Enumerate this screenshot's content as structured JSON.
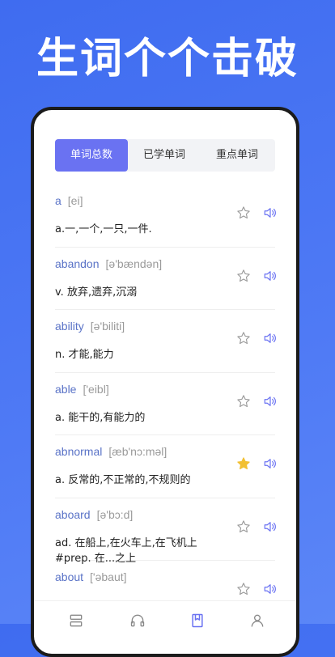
{
  "headline": "生词个个击破",
  "tabs": [
    {
      "label": "单词总数",
      "active": true
    },
    {
      "label": "已学单词",
      "active": false
    },
    {
      "label": "重点单词",
      "active": false
    }
  ],
  "words": [
    {
      "word": "a",
      "phonetic": "[ei]",
      "meaning": "a.一,一个,一只,一件.",
      "starred": false
    },
    {
      "word": "abandon",
      "phonetic": "[ə'bændən]",
      "meaning": "v. 放弃,遗弃,沉溺",
      "starred": false
    },
    {
      "word": "ability",
      "phonetic": "[ə'biliti]",
      "meaning": "n. 才能,能力",
      "starred": false
    },
    {
      "word": "able",
      "phonetic": "['eibl]",
      "meaning": "a. 能干的,有能力的",
      "starred": false
    },
    {
      "word": "abnormal",
      "phonetic": "[æb'nɔ:məl]",
      "meaning": "a. 反常的,不正常的,不规则的",
      "starred": true
    },
    {
      "word": "aboard",
      "phonetic": "[ə'bɔ:d]",
      "meaning": "ad. 在船上,在火车上,在飞机上 #prep. 在...之上",
      "starred": false
    },
    {
      "word": "about",
      "phonetic": "['əbaut]",
      "meaning": "",
      "starred": false
    }
  ],
  "colors": {
    "background": "#4f7af5",
    "tab_active": "#6a72f2",
    "word": "#5a73c7",
    "star_active": "#f2c033",
    "icon": "#6a72f2"
  },
  "icons": {
    "star": "star-icon",
    "speaker": "speaker-icon",
    "nav": [
      "list-icon",
      "headphones-icon",
      "book-icon",
      "user-icon"
    ]
  }
}
